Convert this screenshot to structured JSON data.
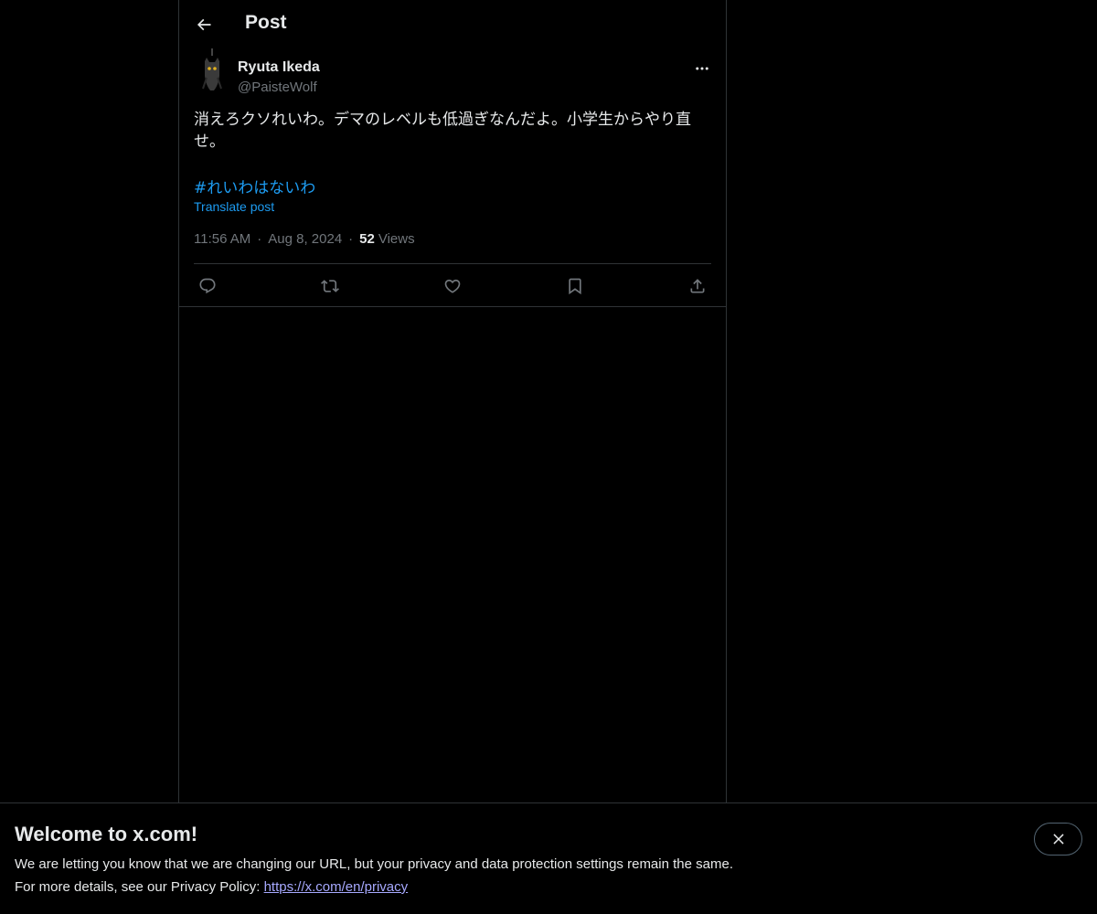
{
  "header": {
    "title": "Post",
    "back_icon": "arrow-left-icon"
  },
  "post": {
    "author_name": "Ryuta Ikeda",
    "author_handle": "@PaisteWolf",
    "text": "消えろクソれいわ。デマのレベルも低過ぎなんだよ。小学生からやり直せ。",
    "hashtag": "#れいわはないわ",
    "translate_label": "Translate post",
    "time": "11:56 AM",
    "date": "Aug 8, 2024",
    "views_count": "52",
    "views_label": "Views",
    "separator": "·",
    "actions": [
      "reply-icon",
      "repost-icon",
      "like-icon",
      "bookmark-icon",
      "share-icon"
    ]
  },
  "banner": {
    "title": "Welcome to x.com!",
    "line1": "We are letting you know that we are changing our URL, but your privacy and data protection settings remain the same.",
    "line2_prefix": "For more details, see our Privacy Policy: ",
    "link": "https://x.com/en/privacy",
    "close_icon": "close-icon"
  },
  "colors": {
    "accent": "#1d9bf0",
    "muted": "#71767b",
    "border": "#2f3336",
    "link": "#a7a9ff"
  }
}
